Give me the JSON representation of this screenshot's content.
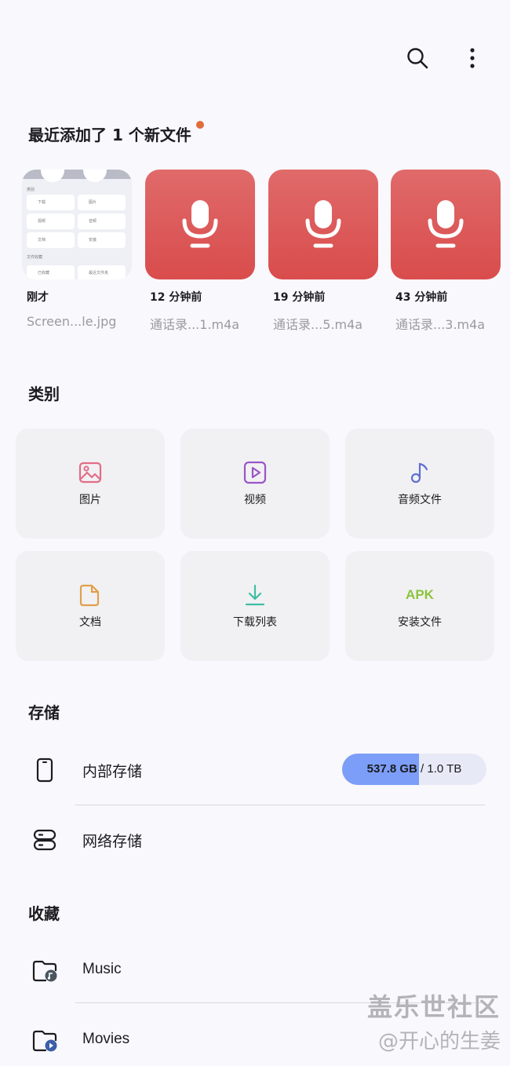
{
  "toolbar": {
    "search_icon": "search-icon",
    "more_icon": "more-vert-icon"
  },
  "recent": {
    "title": "最近添加了 1 个新文件",
    "dot_color": "#e06d3a",
    "items": [
      {
        "time": "刚才",
        "name": "Screen...le.jpg",
        "kind": "image",
        "preview": {
          "section": "类别",
          "cells": [
            "下载",
            "图片",
            "视频",
            "音频",
            "文档",
            "安装"
          ],
          "footer": "文件收藏",
          "foot_items": [
            "已收藏",
            "最近文件夹"
          ]
        }
      },
      {
        "time": "12 分钟前",
        "name": "通话录...1.m4a",
        "kind": "audio"
      },
      {
        "time": "19 分钟前",
        "name": "通话录...5.m4a",
        "kind": "audio"
      },
      {
        "time": "43 分钟前",
        "name": "通话录...3.m4a",
        "kind": "audio"
      }
    ],
    "audio_color": "#d94c4c"
  },
  "categories": {
    "title": "类别",
    "items": [
      {
        "label": "图片",
        "icon": "image-icon",
        "color": "#e26d86"
      },
      {
        "label": "视频",
        "icon": "video-icon",
        "color": "#9a55c6"
      },
      {
        "label": "音频文件",
        "icon": "music-note-icon",
        "color": "#5e6fd0"
      },
      {
        "label": "文档",
        "icon": "document-icon",
        "color": "#e0a04a"
      },
      {
        "label": "下载列表",
        "icon": "download-icon",
        "color": "#3fbea0"
      },
      {
        "label": "安装文件",
        "icon": "apk-icon",
        "icon_text": "APK",
        "color": "#8cc43a"
      }
    ]
  },
  "storage": {
    "title": "存储",
    "internal": {
      "label": "内部存储",
      "used": "537.8 GB",
      "separator": " / ",
      "total": "1.0 TB",
      "used_fraction": 0.53
    },
    "network": {
      "label": "网络存储"
    }
  },
  "favorites": {
    "title": "收藏",
    "items": [
      {
        "label": "Music",
        "icon": "music-folder-icon"
      },
      {
        "label": "Movies",
        "icon": "movies-folder-icon"
      }
    ]
  },
  "watermark": {
    "line1": "盖乐世社区",
    "line2": "@开心的生姜"
  }
}
